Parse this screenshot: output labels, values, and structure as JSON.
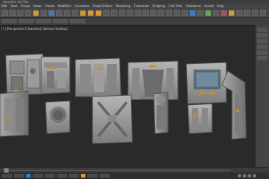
{
  "window": {
    "title": "Autodesk 3ds Max"
  },
  "menu": {
    "items": [
      "Edit",
      "Tools",
      "Group",
      "Views",
      "Create",
      "Modifiers",
      "Animation",
      "Graph Editors",
      "Rendering",
      "Customize",
      "Scripting",
      "Civil View",
      "Substance",
      "Arnold",
      "Help"
    ]
  },
  "viewport": {
    "label": "[+] [Perspective] [Standard] [Default Shading]",
    "background": "#2a2a2a"
  },
  "colors": {
    "accent": "#d99a2b",
    "highlight": "#3a7ac9",
    "panel": "#454545"
  }
}
